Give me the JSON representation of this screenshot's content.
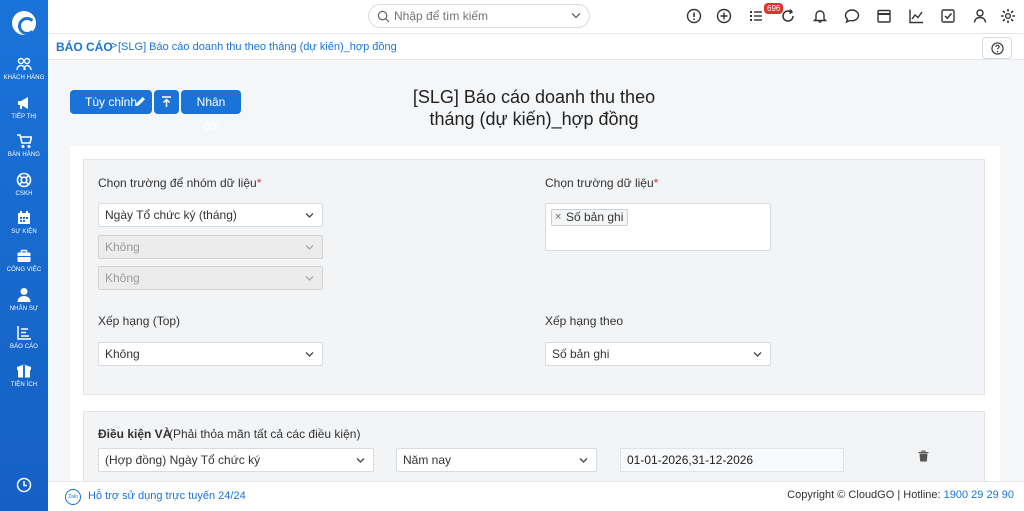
{
  "sidebar": {
    "items": [
      {
        "label": "KHÁCH HÀNG",
        "icon": "users-icon"
      },
      {
        "label": "TIẾP THỊ",
        "icon": "megaphone-icon"
      },
      {
        "label": "BÁN HÀNG",
        "icon": "cart-icon"
      },
      {
        "label": "CSKH",
        "icon": "lifebuoy-icon"
      },
      {
        "label": "SỰ KIỆN",
        "icon": "calendar-icon"
      },
      {
        "label": "CÔNG VIỆC",
        "icon": "briefcase-icon"
      },
      {
        "label": "NHÂN SỰ",
        "icon": "person-icon"
      },
      {
        "label": "BÁO CÁO",
        "icon": "report-icon"
      },
      {
        "label": "TIỆN ÍCH",
        "icon": "box-icon"
      }
    ]
  },
  "search": {
    "placeholder": "Nhập để tìm kiếm"
  },
  "topbar": {
    "notification_count": "696"
  },
  "breadcrumb": {
    "root": "BÁO CÁO",
    "separator": ">",
    "page": "[SLG] Báo cáo doanh thu theo tháng (dự kiến)_hợp đồng"
  },
  "actions": {
    "customize": "Tùy chỉnh",
    "duplicate": "Nhân đôi"
  },
  "report": {
    "title_line1": "[SLG] Báo cáo doanh thu theo",
    "title_line2": "tháng (dự kiến)_hợp đồng"
  },
  "grouping": {
    "label": "Chọn trường để nhóm dữ liệu",
    "required_mark": "*",
    "field1": "Ngày Tổ chức ký (tháng)",
    "field2": "Không",
    "field3": "Không"
  },
  "data_fields": {
    "label": "Chọn trường dữ liệu",
    "required_mark": "*",
    "tag_remove": "×",
    "tags": [
      "Số bản ghi"
    ]
  },
  "ranking": {
    "label": "Xếp hạng (Top)",
    "value": "Không"
  },
  "rank_by": {
    "label": "Xếp hạng theo",
    "value": "Số bản ghi"
  },
  "conditions": {
    "title": "Điều kiện VÀ",
    "note": "(Phải thỏa mãn tất cả các điều kiện)",
    "field": "(Hợp đồng) Ngày Tổ chức ký",
    "operator": "Năm nay",
    "value": "01-01-2026,31-12-2026"
  },
  "footer": {
    "zalo": "Zalo",
    "support": "Hỗ trợ sử dụng trực tuyến 24/24",
    "copyright": "Copyright © CloudGO",
    "hotline_label": "| Hotline:",
    "hotline": "1900 29 29 90"
  }
}
